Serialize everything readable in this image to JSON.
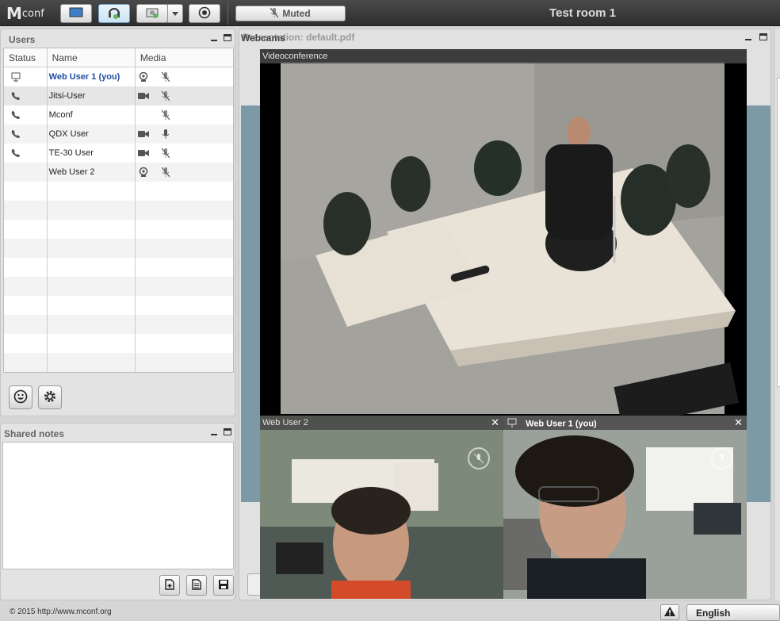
{
  "app": {
    "logo_text_main": "M",
    "logo_text_rest": "conf",
    "room_title": "Test room 1"
  },
  "toolbar": {
    "muted_label": "Muted",
    "icons": [
      "desktop-share-icon",
      "headset-icon",
      "webcam-share-icon",
      "record-icon"
    ]
  },
  "users_window": {
    "title": "Users",
    "columns": {
      "status": "Status",
      "name": "Name",
      "media": "Media"
    },
    "rows": [
      {
        "status": "presenter",
        "name": "Web User 1 (you)",
        "camera": "webcam",
        "mic": "muted",
        "me": true
      },
      {
        "status": "phone",
        "name": "Jitsi-User",
        "camera": "video",
        "mic": "muted"
      },
      {
        "status": "phone",
        "name": "Mconf",
        "camera": "",
        "mic": "muted"
      },
      {
        "status": "phone",
        "name": "QDX User",
        "camera": "video",
        "mic": "active"
      },
      {
        "status": "phone",
        "name": "TE-30 User",
        "camera": "video",
        "mic": "muted"
      },
      {
        "status": "",
        "name": "Web User 2",
        "camera": "webcam",
        "mic": "muted"
      }
    ],
    "empty_rows": 10
  },
  "notes_window": {
    "title": "Shared notes"
  },
  "presentation": {
    "title": "Presentation: default.pdf"
  },
  "webcams": {
    "title": "Webcams",
    "main_video_label": "Videoconference",
    "video_2_label": "Web User 2",
    "video_1_label": "Web User 1 (you)"
  },
  "footer": {
    "copyright": "© 2015 http://www.mconf.org",
    "language": "English"
  },
  "colors": {
    "topbar": "#3a3a3a",
    "me_name": "#1f4fa1",
    "slide_bg": "#7c9aa5"
  }
}
